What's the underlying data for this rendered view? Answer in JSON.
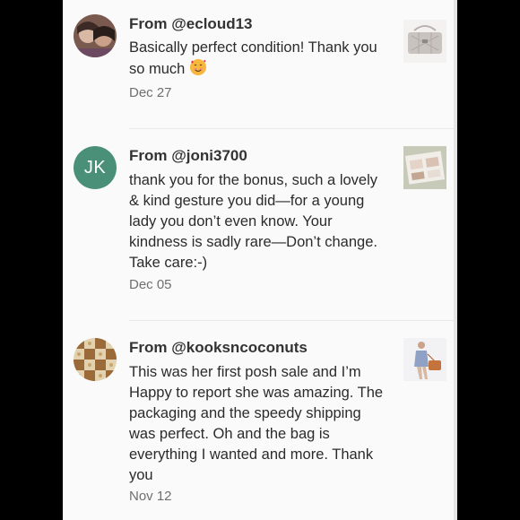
{
  "reviews": [
    {
      "from": "From @ecloud13",
      "text": "Basically perfect condition! Thank you so much",
      "emoji": "smiling-face-with-hearts-icon",
      "date": "Dec 27"
    },
    {
      "from": "From @joni3700",
      "initials": "JK",
      "text": "thank you for the bonus, such a lovely & kind gesture you did—for a young lady you don’t even know. Your kindness is sadly rare—Don’t change. Take care:-)",
      "date": "Dec 05"
    },
    {
      "from": "From @kooksncoconuts",
      "text": "This was her first posh sale and I’m Happy to report she was amazing. The packaging and the speedy shipping was perfect. Oh and the bag is everything I wanted and more. Thank you",
      "date": "Nov 12"
    }
  ],
  "colors": {
    "initials_avatar": "#4a8f78",
    "panel_background": "#fbfafa",
    "outer_background": "#000000"
  }
}
